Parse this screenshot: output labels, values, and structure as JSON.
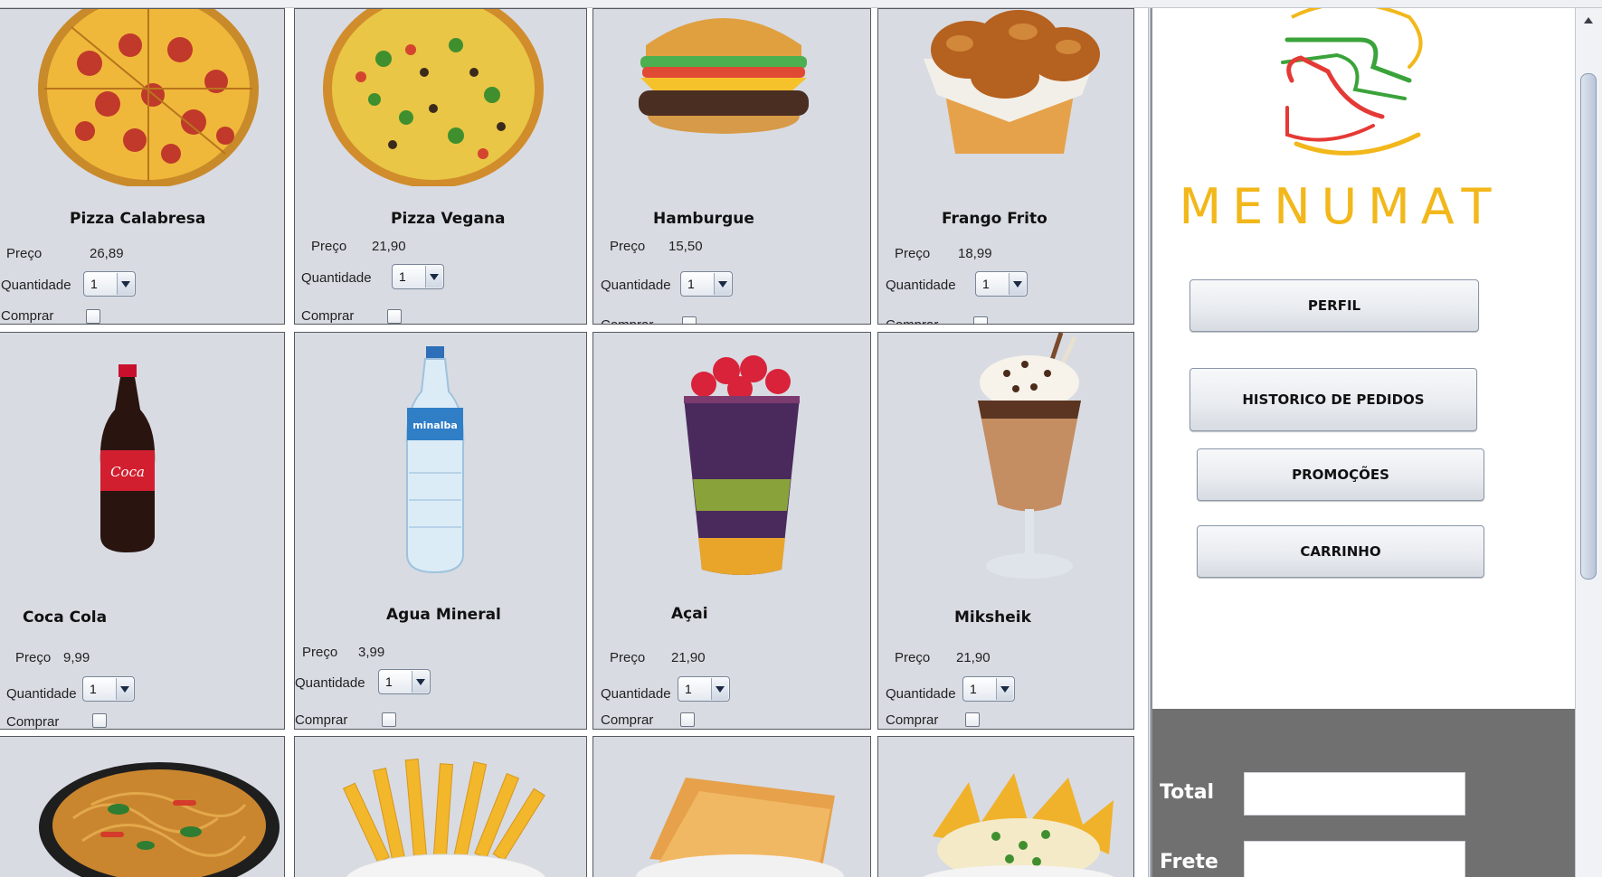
{
  "brand": {
    "name": "MENUMAT",
    "logo": "menumat-burger-logo"
  },
  "sidebar": {
    "buttons": [
      {
        "label": "PERFIL"
      },
      {
        "label": "HISTORICO DE PEDIDOS"
      },
      {
        "label": "PROMOÇÕES"
      },
      {
        "label": "CARRINHO"
      }
    ],
    "total_label": "Total",
    "frete_label": "Frete"
  },
  "labels": {
    "price": "Preço",
    "quantity": "Quantidade",
    "buy": "Comprar"
  },
  "products": [
    {
      "name": "Pizza Calabresa",
      "price": "26,89",
      "qty": "1",
      "image": "pizza-calabresa"
    },
    {
      "name": "Pizza Vegana",
      "price": "21,90",
      "qty": "1",
      "image": "pizza-vegana"
    },
    {
      "name": "Hamburgue",
      "price": "15,50",
      "qty": "1",
      "image": "hamburger"
    },
    {
      "name": "Frango Frito",
      "price": "18,99",
      "qty": "1",
      "image": "fried-chicken"
    },
    {
      "name": "Coca Cola",
      "price": "9,99",
      "qty": "1",
      "image": "coca-cola-bottle"
    },
    {
      "name": "Agua Mineral",
      "price": "3,99",
      "qty": "1",
      "image": "water-bottle"
    },
    {
      "name": "Açai",
      "price": "21,90",
      "qty": "1",
      "image": "acai-cup"
    },
    {
      "name": "Miksheik",
      "price": "21,90",
      "qty": "1",
      "image": "milkshake"
    },
    {
      "image": "noodles-bowl"
    },
    {
      "image": "french-fries"
    },
    {
      "image": "pastel"
    },
    {
      "image": "nachos"
    }
  ]
}
